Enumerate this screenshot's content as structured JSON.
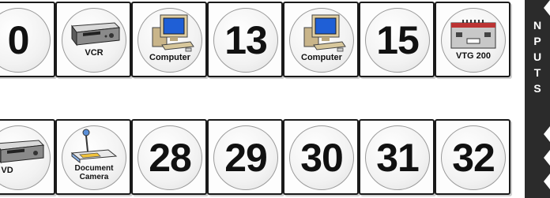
{
  "side_label": {
    "letters": [
      "N",
      "P",
      "U",
      "T",
      "S"
    ]
  },
  "top_row": [
    {
      "type": "number",
      "label": "0"
    },
    {
      "type": "device",
      "icon": "vcr-icon",
      "label": "VCR"
    },
    {
      "type": "device",
      "icon": "computer-icon",
      "label": "Computer"
    },
    {
      "type": "number",
      "label": "13"
    },
    {
      "type": "device",
      "icon": "computer-icon",
      "label": "Computer"
    },
    {
      "type": "number",
      "label": "15"
    },
    {
      "type": "device",
      "icon": "vtg-icon",
      "label": "VTG 200"
    }
  ],
  "bottom_row": [
    {
      "type": "device",
      "icon": "dvd-player-icon",
      "label": "VD"
    },
    {
      "type": "device",
      "icon": "document-camera-icon",
      "label": "Document Camera"
    },
    {
      "type": "number",
      "label": "28"
    },
    {
      "type": "number",
      "label": "29"
    },
    {
      "type": "number",
      "label": "30"
    },
    {
      "type": "number",
      "label": "31"
    },
    {
      "type": "number",
      "label": "32"
    }
  ]
}
